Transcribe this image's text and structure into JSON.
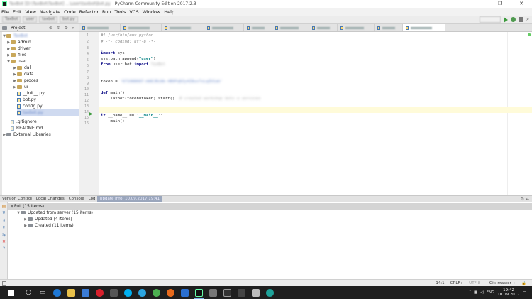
{
  "titlebar": {
    "project_name": "TaxBot",
    "project_path": "[D:\\TaxBot\\TaxBot]",
    "file_path": "...\\user\\taxbot\\bot.py",
    "app_title": "- PyCharm Community Edition 2017.2.3",
    "minimize": "—",
    "maximize": "❐",
    "close": "✕"
  },
  "menu": [
    "File",
    "Edit",
    "View",
    "Navigate",
    "Code",
    "Refactor",
    "Run",
    "Tools",
    "VCS",
    "Window",
    "Help"
  ],
  "navbar": {
    "crumbs": [
      "TaxBot",
      "user",
      "taxbot",
      "bot.py"
    ]
  },
  "project_panel": {
    "label": "Project",
    "root": "TaxBot",
    "items": [
      {
        "label": "admin",
        "kind": "folder"
      },
      {
        "label": "driver",
        "kind": "folder"
      },
      {
        "label": "files",
        "kind": "folder"
      },
      {
        "label": "user",
        "kind": "folder"
      },
      {
        "label": "dal",
        "kind": "folder"
      },
      {
        "label": "data",
        "kind": "folder"
      },
      {
        "label": "proces",
        "kind": "folder"
      },
      {
        "label": "ui",
        "kind": "folder"
      },
      {
        "label": "__init__.py",
        "kind": "py"
      },
      {
        "label": "bot.py",
        "kind": "py"
      },
      {
        "label": "config.py",
        "kind": "py"
      },
      {
        "label": "taxbot.py",
        "kind": "py"
      },
      {
        "label": ".gitignore",
        "kind": "file"
      },
      {
        "label": "README.md",
        "kind": "file"
      },
      {
        "label": "External Libraries",
        "kind": "lib"
      }
    ]
  },
  "editor": {
    "line_numbers": [
      "1",
      "2",
      "3",
      "4",
      "5",
      "6",
      "7",
      "8",
      "9",
      "10",
      "11",
      "12",
      "13",
      "14",
      "15",
      "16"
    ],
    "shebang": "#! /usr/bin/env python",
    "encoding": "# -*- coding: utf-8 -*-",
    "import_kw": "import",
    "import_mod": "sys",
    "path_call": "sys.path.append(",
    "path_arg": "\"user\"",
    "path_close": ")",
    "from_kw": "from",
    "from_mod": "user.bot",
    "from_import_kw": "import",
    "from_name": "TaxBot",
    "token_lhs": "token = ",
    "token_value": "'671988687:AAEJBi8b-4B9FqDZy4Z8ux7sLqZU1ab'",
    "def_kw": "def",
    "def_sig": "main():",
    "body_call": "    TaxBot(token=token).start()",
    "body_comment": "# created workshop bots a services",
    "if_kw": "if",
    "if_cond": "__name__ == ",
    "if_str": "'__main__'",
    "if_colon": ":",
    "main_call": "    main()"
  },
  "bottom_panel": {
    "tabs": [
      "Version Control",
      "Local Changes",
      "Console",
      "Log"
    ],
    "info_tab": "Update info: 10.09.2017 19:41",
    "tools": "⚙ ⇤",
    "rows": [
      {
        "label": "Pull (15 items)"
      },
      {
        "label": "Updated from server (15 items)"
      },
      {
        "label": "Updated (4 items)"
      },
      {
        "label": "Created (11 items)"
      }
    ]
  },
  "statusbar": {
    "position": "14:1",
    "line_sep": "CRLF÷",
    "encoding": "UTF-8÷",
    "git": "Git: master ÷"
  },
  "taskbar": {
    "lang": "ENG",
    "time": "19:42",
    "date": "10.09.2017"
  },
  "colors": {
    "keyword": "#000080",
    "string": "#008080",
    "comment": "#8c8c8c",
    "selection": "#cfdaf0",
    "taskbar": "#1f1f1f"
  }
}
